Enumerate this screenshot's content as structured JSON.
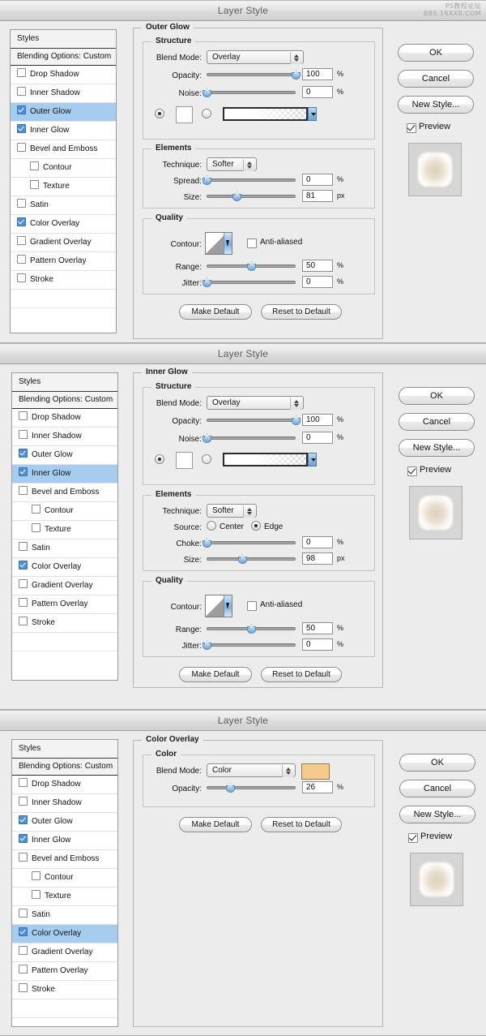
{
  "watermark": {
    "line1": "PS教程论坛",
    "line2": "BBS.16XX8.COM"
  },
  "common": {
    "title": "Layer Style",
    "styles_header": "Styles",
    "blending_options": "Blending Options: Custom",
    "ok": "OK",
    "cancel": "Cancel",
    "new_style": "New Style...",
    "preview": "Preview",
    "make_default": "Make Default",
    "reset_to_default": "Reset to Default",
    "structure": "Structure",
    "elements": "Elements",
    "quality": "Quality",
    "blend_mode_label": "Blend Mode:",
    "opacity_label": "Opacity:",
    "noise_label": "Noise:",
    "technique_label": "Technique:",
    "size_label": "Size:",
    "contour_label": "Contour:",
    "anti_aliased": "Anti-aliased",
    "range_label": "Range:",
    "jitter_label": "Jitter:",
    "percent": "%",
    "px": "px"
  },
  "fx_list": [
    {
      "label": "Drop Shadow",
      "checked": false,
      "indent": false
    },
    {
      "label": "Inner Shadow",
      "checked": false,
      "indent": false
    },
    {
      "label": "Outer Glow",
      "checked": true,
      "indent": false
    },
    {
      "label": "Inner Glow",
      "checked": true,
      "indent": false
    },
    {
      "label": "Bevel and Emboss",
      "checked": false,
      "indent": false
    },
    {
      "label": "Contour",
      "checked": false,
      "indent": true
    },
    {
      "label": "Texture",
      "checked": false,
      "indent": true
    },
    {
      "label": "Satin",
      "checked": false,
      "indent": false
    },
    {
      "label": "Color Overlay",
      "checked": true,
      "indent": false
    },
    {
      "label": "Gradient Overlay",
      "checked": false,
      "indent": false
    },
    {
      "label": "Pattern Overlay",
      "checked": false,
      "indent": false
    },
    {
      "label": "Stroke",
      "checked": false,
      "indent": false
    }
  ],
  "dialog1": {
    "selected_fx": "Outer Glow",
    "group_title": "Outer Glow",
    "blend_mode": "Overlay",
    "opacity_value": "100",
    "opacity_pct": 100,
    "noise_value": "0",
    "noise_pct": 0,
    "technique": "Softer",
    "spread_label": "Spread:",
    "spread_value": "0",
    "spread_pct": 0,
    "size_value": "81",
    "size_pct": 34,
    "range_value": "50",
    "range_pct": 50,
    "jitter_value": "0",
    "jitter_pct": 0,
    "anti_aliased_checked": false
  },
  "dialog2": {
    "selected_fx": "Inner Glow",
    "group_title": "Inner Glow",
    "blend_mode": "Overlay",
    "opacity_value": "100",
    "opacity_pct": 100,
    "noise_value": "0",
    "noise_pct": 0,
    "technique": "Softer",
    "source_label": "Source:",
    "source_center": "Center",
    "source_edge": "Edge",
    "source_selected": "Edge",
    "choke_label": "Choke:",
    "choke_value": "0",
    "choke_pct": 0,
    "size_value": "98",
    "size_pct": 40,
    "range_value": "50",
    "range_pct": 50,
    "jitter_value": "0",
    "jitter_pct": 0,
    "anti_aliased_checked": false
  },
  "dialog3": {
    "selected_fx": "Color Overlay",
    "group_title": "Color Overlay",
    "sub_title": "Color",
    "blend_mode": "Color",
    "color_swatch": "#f6c98c",
    "opacity_value": "26",
    "opacity_pct": 26
  }
}
